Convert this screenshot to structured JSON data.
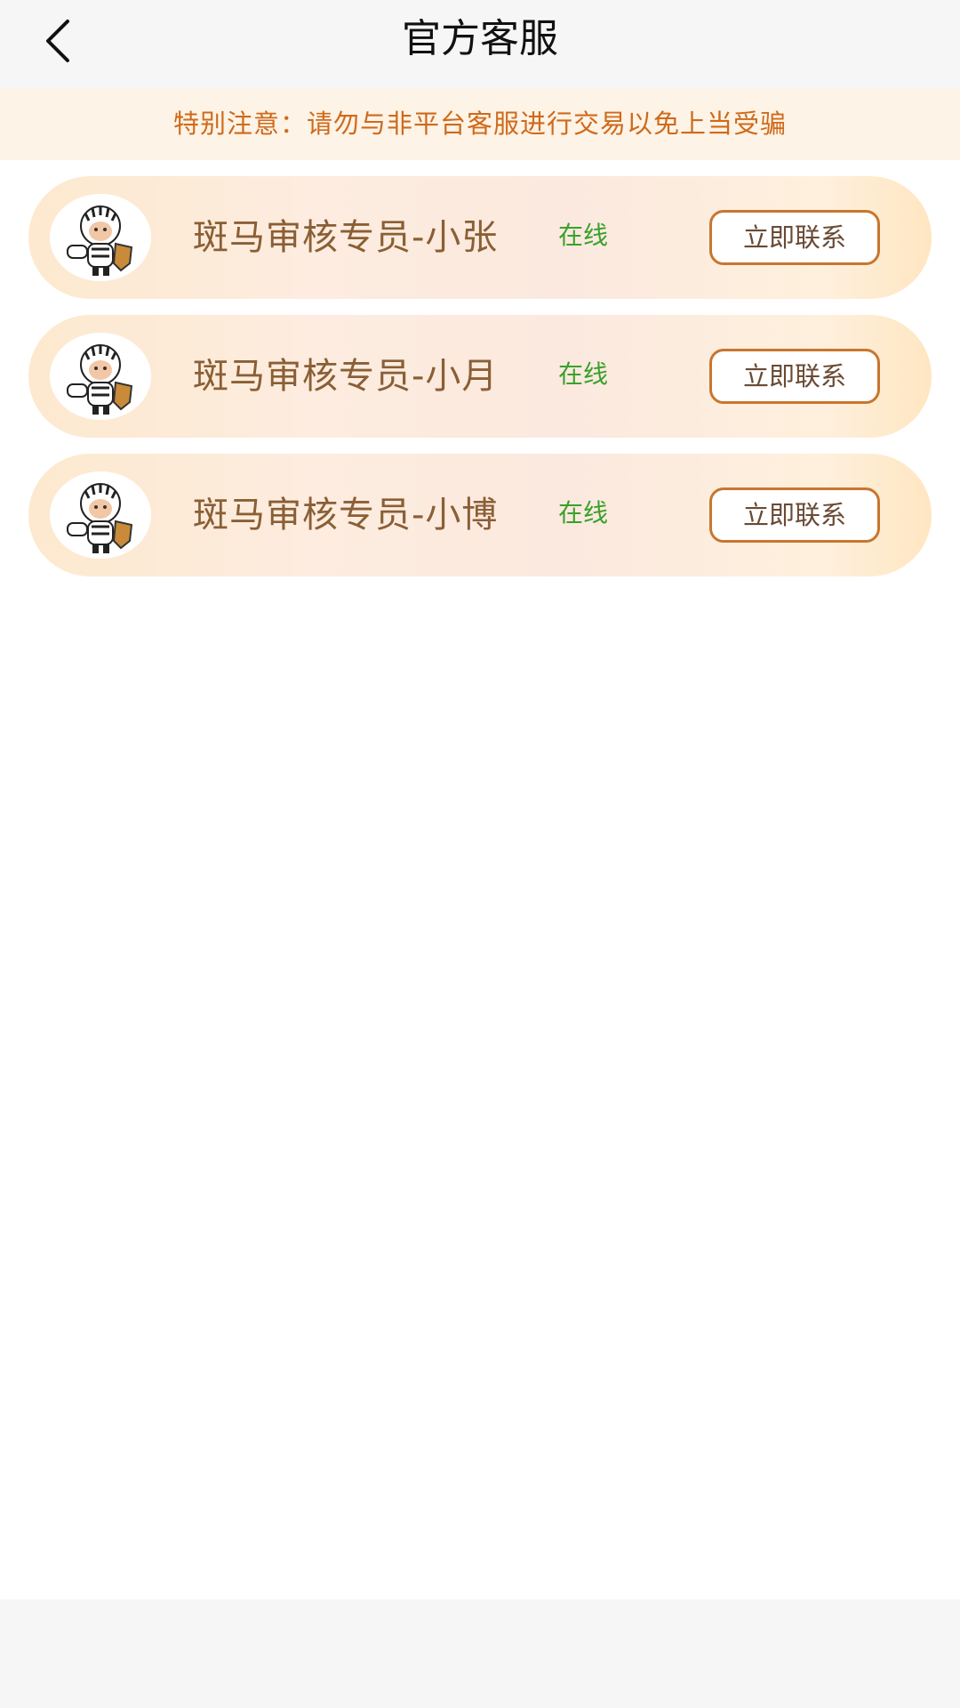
{
  "header": {
    "title": "官方客服",
    "back_icon": "chevron-left-icon"
  },
  "notice": {
    "text": "特别注意：请勿与非平台客服进行交易以免上当受骗",
    "color": "#cf6a1b"
  },
  "agents": [
    {
      "name": "斑马审核专员-小张",
      "status": "在线",
      "button_label": "立即联系",
      "avatar_icon": "zebra-mascot-icon"
    },
    {
      "name": "斑马审核专员-小月",
      "status": "在线",
      "button_label": "立即联系",
      "avatar_icon": "zebra-mascot-icon"
    },
    {
      "name": "斑马审核专员-小博",
      "status": "在线",
      "button_label": "立即联系",
      "avatar_icon": "zebra-mascot-icon"
    }
  ],
  "colors": {
    "accent": "#c8762f",
    "online": "#3aa12a",
    "name_text": "#8a5f35"
  }
}
